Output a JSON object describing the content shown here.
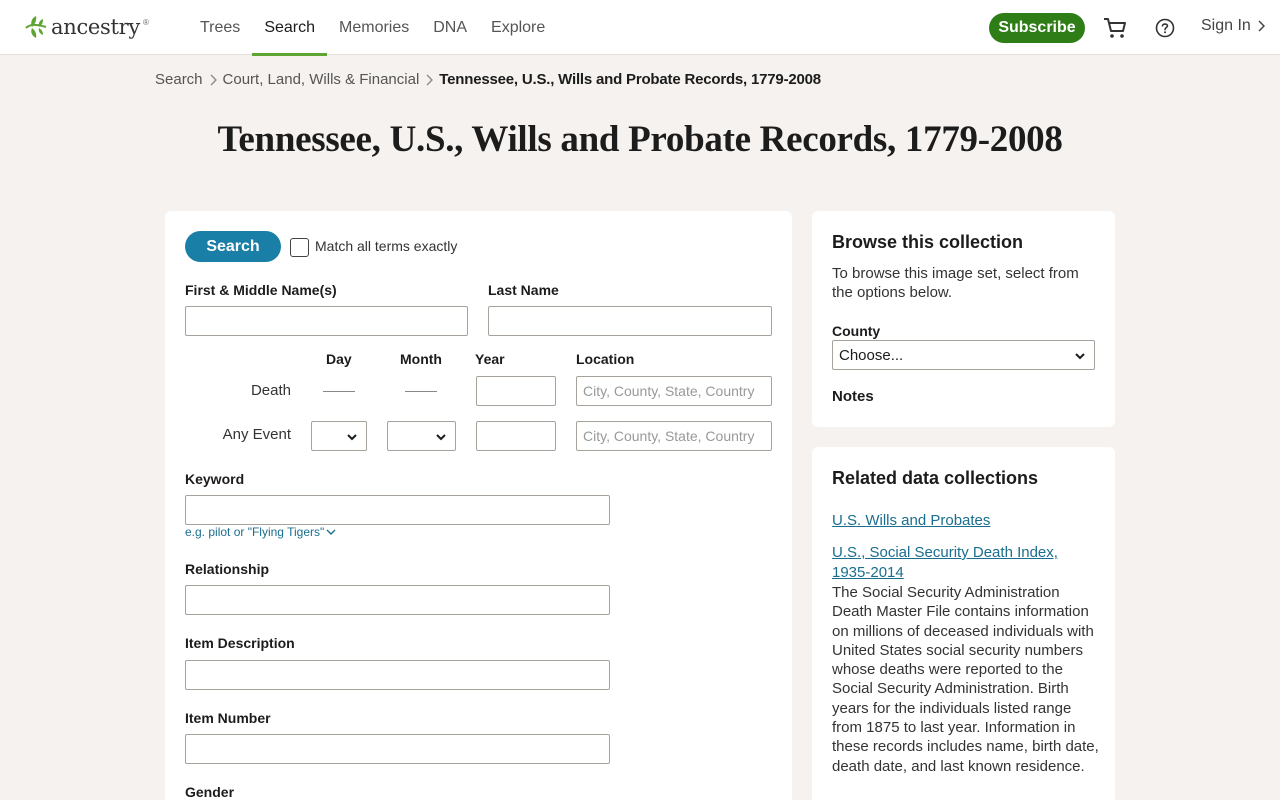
{
  "header": {
    "logo_text": "ancestry",
    "logo_tm": "®",
    "nav": [
      {
        "label": "Trees"
      },
      {
        "label": "Search"
      },
      {
        "label": "Memories"
      },
      {
        "label": "DNA"
      },
      {
        "label": "Explore"
      }
    ],
    "active_nav": "Search",
    "subscribe_label": "Subscribe",
    "signin_label": "Sign In",
    "brand_color": "#5ea534",
    "subscribe_color": "#2e7d16"
  },
  "breadcrumb": {
    "items": [
      "Search",
      "Court, Land, Wills & Financial"
    ],
    "current": "Tennessee, U.S., Wills and Probate Records, 1779-2008"
  },
  "page_title": "Tennessee, U.S., Wills and Probate Records, 1779-2008",
  "form": {
    "search_label": "Search",
    "match_label": "Match all terms exactly",
    "match_checked": false,
    "first_name_label": "First & Middle Name(s)",
    "last_name_label": "Last Name",
    "columns": {
      "day": "Day",
      "month": "Month",
      "year": "Year",
      "location": "Location"
    },
    "death_label": "Death",
    "any_event_label": "Any Event",
    "location_placeholder": "City, County, State, Country",
    "keyword_label": "Keyword",
    "keyword_hint": "e.g. pilot or \"Flying Tigers\"",
    "relationship_label": "Relationship",
    "item_description_label": "Item Description",
    "item_number_label": "Item Number",
    "gender_label": "Gender",
    "accent_color": "#1a7fa6"
  },
  "browse": {
    "title": "Browse this collection",
    "description": "To browse this image set, select from the options below.",
    "county_label": "County",
    "county_value": "Choose...",
    "notes_label": "Notes"
  },
  "related": {
    "title": "Related data collections",
    "links": [
      {
        "label": "U.S. Wills and Probates"
      },
      {
        "label": "U.S., Social Security Death Index, 1935-2014"
      }
    ],
    "ssdi_description": "The Social Security Administration Death Master File contains information on millions of deceased individuals with United States social security numbers whose deaths were reported to the Social Security Administration. Birth years for the individuals listed range from 1875 to last year. Information in these records includes name, birth date, death date, and last known residence.",
    "link_color": "#1a6e8e"
  }
}
